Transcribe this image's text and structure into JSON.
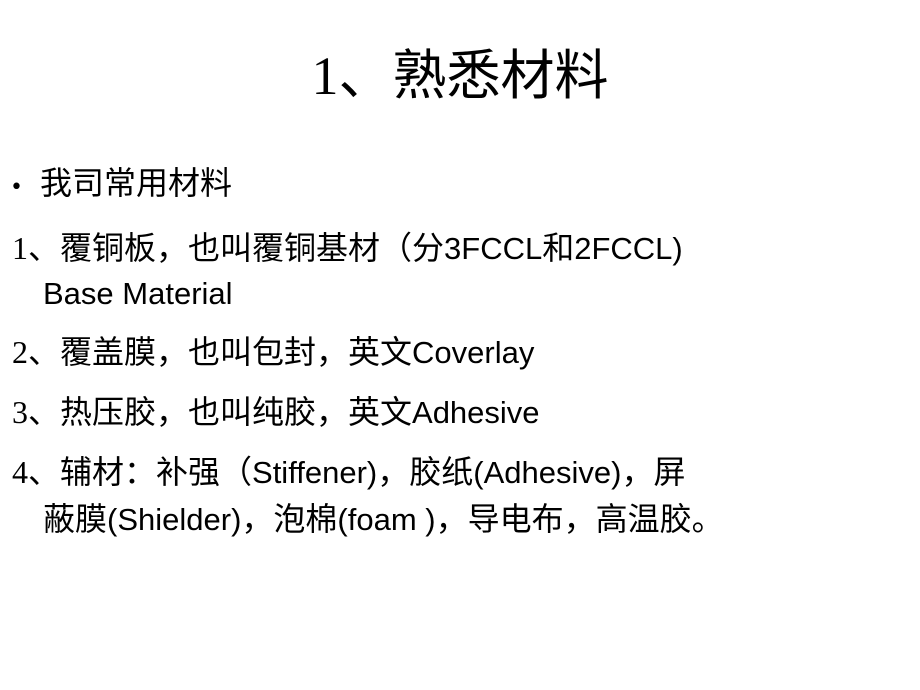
{
  "slide": {
    "background_color": "#ffffff",
    "text_color": "#000000",
    "title": "1、熟悉材料",
    "bullet_glyph": "•",
    "body": {
      "intro": "我司常用材料",
      "items": [
        {
          "line_1_cjk_a": "1、覆铜板，也叫覆铜基材（分",
          "line_1_latin_a": "3FCCL",
          "line_1_cjk_b": "和",
          "line_1_latin_b": "2FCCL)",
          "line_2_latin": "Base Material"
        },
        {
          "line_1_cjk_a": "2、覆盖膜，也叫包封，英文",
          "line_1_latin_a": "Coverlay"
        },
        {
          "line_1_cjk_a": "3、热压胶，也叫纯胶，英文",
          "line_1_latin_a": "Adhesive"
        },
        {
          "line_1_cjk_a": "4、辅材：补强（",
          "line_1_latin_a": "Stiffener)",
          "line_1_cjk_b": "，胶纸",
          "line_1_latin_b": "(Adhesive)",
          "line_1_cjk_c": "，屏",
          "line_2_cjk_a": "蔽膜",
          "line_2_latin_a": "(Shielder)",
          "line_2_cjk_b": "，泡棉",
          "line_2_latin_b": "(foam )",
          "line_2_cjk_c": "，导电布，高温胶。"
        }
      ]
    }
  }
}
